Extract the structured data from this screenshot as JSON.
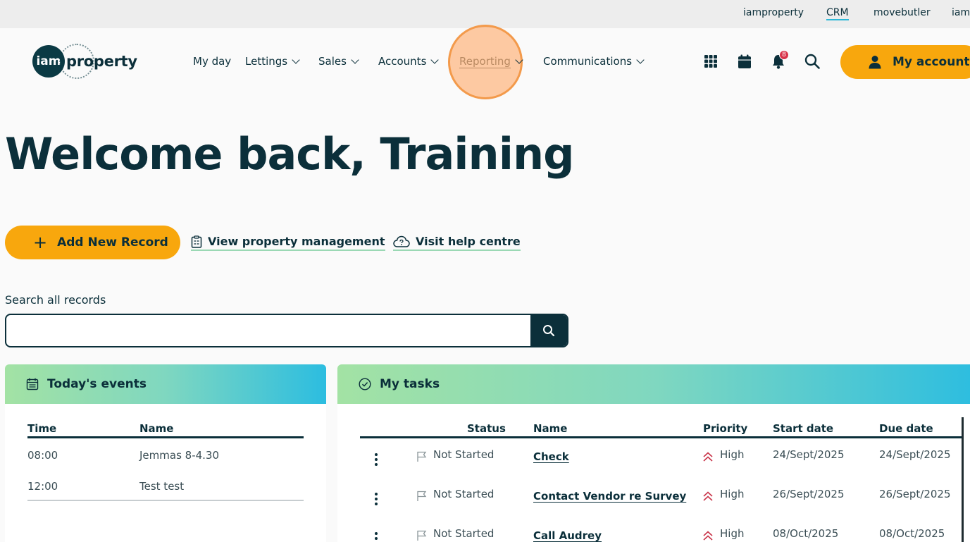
{
  "topbar": {
    "links": [
      "iamproperty",
      "CRM",
      "movebutler",
      "iams"
    ]
  },
  "logo": {
    "circle_text": "iam",
    "word": "property"
  },
  "nav": {
    "items": [
      "My day",
      "Lettings",
      "Sales",
      "Accounts",
      "Reporting",
      "Communications"
    ]
  },
  "header_icons": [
    "apps-grid-icon",
    "calendar-icon",
    "bell-icon",
    "search-icon"
  ],
  "notifications": {
    "count": "8"
  },
  "account": {
    "label": "My account"
  },
  "welcome": {
    "title": "Welcome back, Training"
  },
  "actions": {
    "add_label": "Add New Record",
    "property_management_label": "View property management",
    "help_centre_label": "Visit help centre"
  },
  "search": {
    "label": "Search all records",
    "value": "",
    "placeholder": ""
  },
  "events": {
    "title": "Today's events",
    "columns": [
      "Time",
      "Name"
    ],
    "rows": [
      {
        "time": "08:00",
        "name": "Jemmas 8-4.30"
      },
      {
        "time": "12:00",
        "name": "Test test"
      }
    ]
  },
  "tasks": {
    "title": "My tasks",
    "columns": [
      "Status",
      "Name",
      "Priority",
      "Start date",
      "Due date"
    ],
    "rows": [
      {
        "status": "Not Started",
        "name": "Check",
        "priority": "High",
        "start": "24/Sept/2025",
        "due": "24/Sept/2025"
      },
      {
        "status": "Not Started",
        "name": "Contact Vendor re Survey",
        "priority": "High",
        "start": "26/Sept/2025",
        "due": "26/Sept/2025"
      },
      {
        "status": "Not Started",
        "name": "Call Audrey",
        "priority": "High",
        "start": "08/Oct/2025",
        "due": "08/Oct/2025"
      }
    ]
  },
  "colors": {
    "accent": "#f8a70d",
    "brand_dark": "#0b2f3a",
    "highlight": "#f39a4b",
    "priority": "#c9354a"
  }
}
